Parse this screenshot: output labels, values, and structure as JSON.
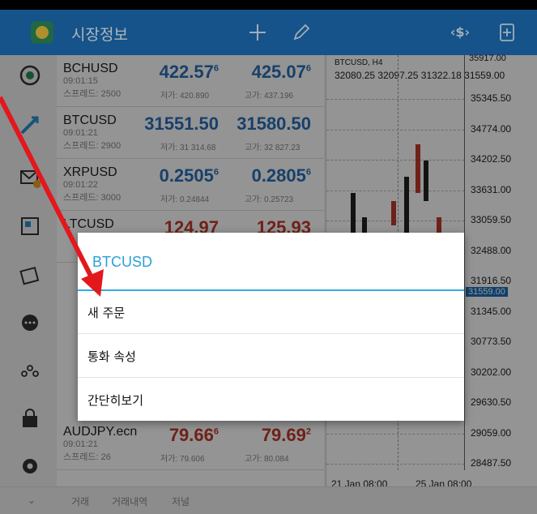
{
  "header": {
    "title": "시장정보",
    "icons": [
      "app-logo",
      "add-icon",
      "edit-icon",
      "currency-icon",
      "new-order-icon"
    ]
  },
  "sidebar": {
    "icons": [
      "quotes-icon",
      "trade-icon",
      "mail-icon",
      "news-icon",
      "calendar-icon",
      "chat-icon",
      "community-icon",
      "market-icon",
      "settings-icon"
    ],
    "mail_badge": "1"
  },
  "quotes": [
    {
      "symbol": "BCHUSD",
      "time": "09:01:15",
      "spread": "스프레드: 2500",
      "bid_main": "422.57",
      "bid_sup": "6",
      "ask_main": "425.07",
      "ask_sup": "6",
      "low": "저가: 420.890",
      "high": "고가: 437.196",
      "color": "blue"
    },
    {
      "symbol": "BTCUSD",
      "time": "09:01:21",
      "spread": "스프레드: 2900",
      "bid_main": "31551.50",
      "bid_sup": "",
      "ask_main": "31580.50",
      "ask_sup": "",
      "low": "저가: 31 314.68",
      "high": "고가: 32 827.23",
      "color": "blue"
    },
    {
      "symbol": "XRPUSD",
      "time": "09:01:22",
      "spread": "스프레드: 3000",
      "bid_main": "0.2505",
      "bid_sup": "6",
      "ask_main": "0.2805",
      "ask_sup": "6",
      "low": "저가: 0.24844",
      "high": "고가: 0.25723",
      "color": "blue"
    },
    {
      "symbol": "LTCUSD",
      "time": "",
      "spread": "",
      "bid_main": "124.97",
      "bid_sup": "",
      "ask_main": "125.93",
      "ask_sup": "",
      "low": "",
      "high": "",
      "color": "red"
    },
    {
      "symbol": "AUDJPY.ecn",
      "time": "09:01:21",
      "spread": "스프레드: 26",
      "bid_main": "79.66",
      "bid_sup": "6",
      "ask_main": "79.69",
      "ask_sup": "2",
      "low": "저가: 79.606",
      "high": "고가: 80.084",
      "color": "red"
    }
  ],
  "chart": {
    "title": "BTCUSD, H4",
    "prices": "32080.25 32097.25 31322.18 31559.00",
    "top_price": "35917.00",
    "current_price": "31559.00",
    "y_labels": [
      "35345.50",
      "34774.00",
      "34202.50",
      "33631.00",
      "33059.50",
      "32488.00",
      "31916.50",
      "31345.00",
      "30773.50",
      "30202.00",
      "29630.50",
      "29059.00",
      "28487.50"
    ],
    "x_labels": [
      "21 Jan 08:00",
      "25 Jan 08:00"
    ]
  },
  "bottom_nav": [
    "거래",
    "거래내역",
    "저널"
  ],
  "dialog": {
    "title": "BTCUSD",
    "items": [
      "새 주문",
      "통화 속성",
      "간단히보기"
    ]
  },
  "colors": {
    "header": "#1c6fb8",
    "accent": "#2ba0d8",
    "bid_blue": "#2a6fb7",
    "bid_red": "#c0392b",
    "annotation_arrow": "#e3181d"
  }
}
